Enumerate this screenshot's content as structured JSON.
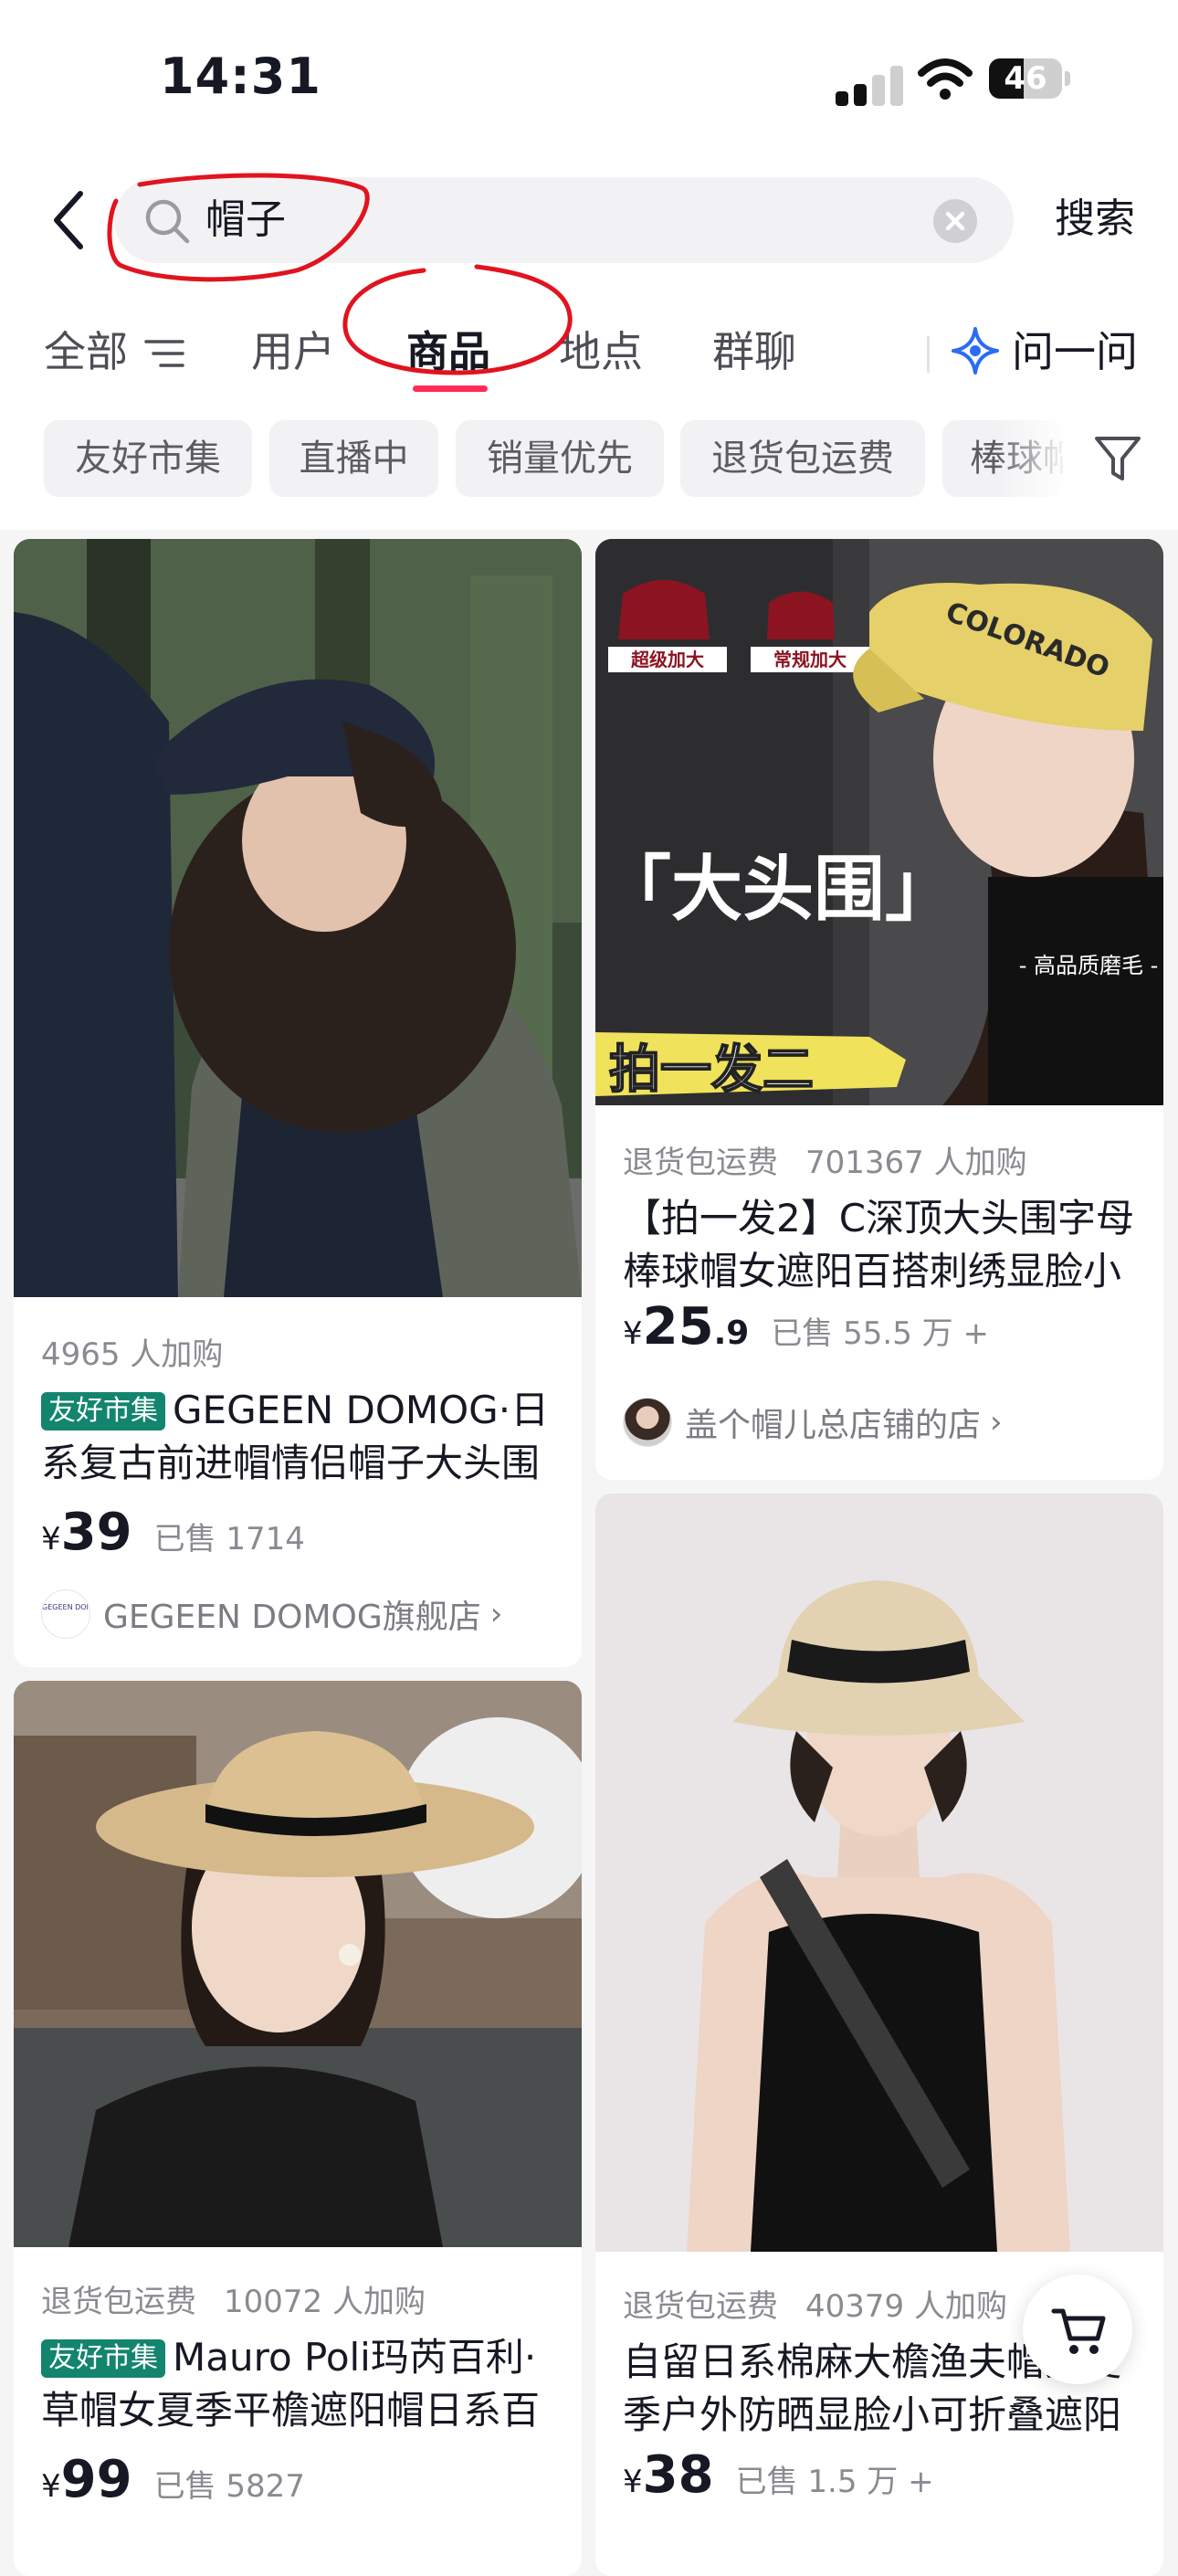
{
  "status_bar": {
    "time": "14:31",
    "battery_level": "46",
    "icons": [
      "cellular-signal-icon",
      "wifi-icon",
      "battery-icon"
    ]
  },
  "search": {
    "query": "帽子",
    "submit_label": "搜索",
    "icons": [
      "back-icon",
      "search-icon",
      "clear-icon"
    ]
  },
  "tabs": [
    {
      "label": "全部",
      "icon": "filter-lines-icon"
    },
    {
      "label": "用户"
    },
    {
      "label": "商品",
      "active": true
    },
    {
      "label": "地点"
    },
    {
      "label": "群聊"
    }
  ],
  "ask": {
    "label": "问一问",
    "icon": "sparkle-star-icon"
  },
  "filter_chips": [
    "友好市集",
    "直播中",
    "销量优先",
    "退货包运费",
    "棒球帽"
  ],
  "filter_icon": "funnel-icon",
  "accent_colors": {
    "brand": "#fe2c55",
    "badge": "#13856e",
    "annotation": "#e0141f"
  },
  "products": [
    {
      "added": "4965 人加购",
      "badge": "友好市集",
      "title": "GEGEEN DOMOG·日系复古前进帽情侣帽子大头围",
      "price_yen": "¥",
      "price_int": "39",
      "price_dec": "",
      "sold": "已售 1714",
      "shop": "GEGEEN DOMOG旗舰店",
      "shop_logo_text": "GEGEEN DOMOG"
    },
    {
      "tag": "退货包运费",
      "added": "701367 人加购",
      "title": "【拍一发2】C深顶大头围字母棒球帽女遮阳百搭刺绣显脸小",
      "price_yen": "¥",
      "price_int": "25",
      "price_dec": ".9",
      "sold": "已售 55.5 万 +",
      "shop": "盖个帽儿总店铺的店",
      "image_text": {
        "size_label_1": "超级加大",
        "size_label_2": "常规加大",
        "headline": "「大头围」",
        "quality": "- 高品质磨毛 -",
        "promo": "拍一发二",
        "cap_text": "COLORADO"
      }
    },
    {
      "tag": "退货包运费",
      "added": "10072 人加购",
      "badge": "友好市集",
      "title": "Mauro Poli玛芮百利·草帽女夏季平檐遮阳帽日系百",
      "price_yen": "¥",
      "price_int": "99",
      "price_dec": "",
      "sold": "已售 5827"
    },
    {
      "tag": "退货包运费",
      "added": "40379 人加购",
      "title": "自留日系棉麻大檐渔夫帽女夏季户外防晒显脸小可折叠遮阳",
      "price_yen": "¥",
      "price_int": "38",
      "price_dec": "",
      "sold": "已售 1.5 万 +"
    }
  ],
  "cart_icon": "shopping-cart-icon"
}
